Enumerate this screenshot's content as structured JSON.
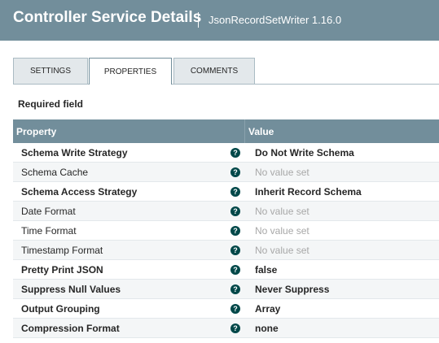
{
  "header": {
    "title": "Controller Service Details",
    "subtitle": "JsonRecordSetWriter 1.16.0"
  },
  "tabs": [
    {
      "label": "SETTINGS",
      "active": false
    },
    {
      "label": "PROPERTIES",
      "active": true
    },
    {
      "label": "COMMENTS",
      "active": false
    }
  ],
  "required_label": "Required field",
  "grid": {
    "columns": [
      "Property",
      "Value"
    ],
    "help_glyph": "?",
    "rows": [
      {
        "name": "Schema Write Strategy",
        "required": true,
        "value": "Do Not Write Schema",
        "set": true
      },
      {
        "name": "Schema Cache",
        "required": false,
        "value": "No value set",
        "set": false
      },
      {
        "name": "Schema Access Strategy",
        "required": true,
        "value": "Inherit Record Schema",
        "set": true
      },
      {
        "name": "Date Format",
        "required": false,
        "value": "No value set",
        "set": false
      },
      {
        "name": "Time Format",
        "required": false,
        "value": "No value set",
        "set": false
      },
      {
        "name": "Timestamp Format",
        "required": false,
        "value": "No value set",
        "set": false
      },
      {
        "name": "Pretty Print JSON",
        "required": true,
        "value": "false",
        "set": true
      },
      {
        "name": "Suppress Null Values",
        "required": true,
        "value": "Never Suppress",
        "set": true
      },
      {
        "name": "Output Grouping",
        "required": true,
        "value": "Array",
        "set": true
      },
      {
        "name": "Compression Format",
        "required": true,
        "value": "none",
        "set": true
      }
    ]
  },
  "colors": {
    "header_bg": "#728e9b",
    "help_icon": "#004849",
    "unset_value": "#a8a8a8"
  }
}
